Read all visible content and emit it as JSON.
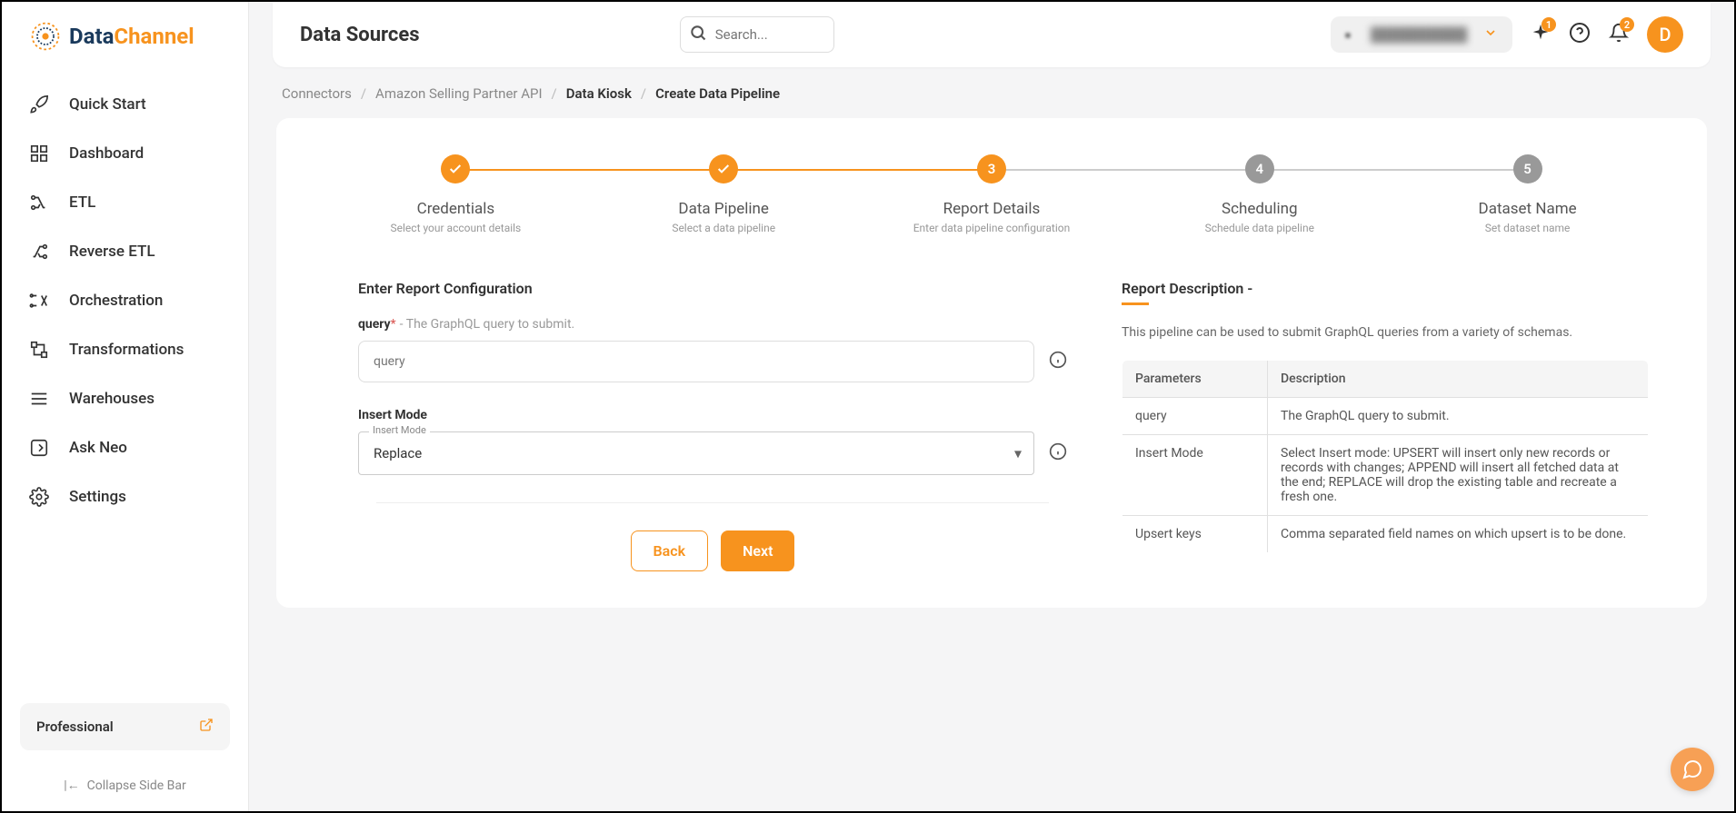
{
  "brand": {
    "part1": "Data",
    "part2": "Channel"
  },
  "sidebar": {
    "items": [
      {
        "label": "Quick Start"
      },
      {
        "label": "Dashboard"
      },
      {
        "label": "ETL"
      },
      {
        "label": "Reverse ETL"
      },
      {
        "label": "Orchestration"
      },
      {
        "label": "Transformations"
      },
      {
        "label": "Warehouses"
      },
      {
        "label": "Ask Neo"
      },
      {
        "label": "Settings"
      }
    ],
    "plan": "Professional",
    "collapse": "Collapse Side Bar"
  },
  "topbar": {
    "title": "Data Sources",
    "search_placeholder": "Search...",
    "workspace": "██████████",
    "badge1": "1",
    "badge2": "2",
    "avatar": "D"
  },
  "breadcrumb": {
    "c0": "Connectors",
    "c1": "Amazon Selling Partner API",
    "c2": "Data Kiosk",
    "c3": "Create Data Pipeline"
  },
  "steps": [
    {
      "title": "Credentials",
      "sub": "Select your account details",
      "num": "✓"
    },
    {
      "title": "Data Pipeline",
      "sub": "Select a data pipeline",
      "num": "✓"
    },
    {
      "title": "Report Details",
      "sub": "Enter data pipeline configuration",
      "num": "3"
    },
    {
      "title": "Scheduling",
      "sub": "Schedule data pipeline",
      "num": "4"
    },
    {
      "title": "Dataset Name",
      "sub": "Set dataset name",
      "num": "5"
    }
  ],
  "form": {
    "section_title": "Enter Report Configuration",
    "query_label": "query",
    "query_required": "*",
    "query_hint": "- The GraphQL query to submit.",
    "query_placeholder": "query",
    "insert_mode_label": "Insert Mode",
    "insert_mode_float": "Insert Mode",
    "insert_mode_value": "Replace",
    "back": "Back",
    "next": "Next"
  },
  "desc": {
    "title": "Report Description -",
    "text": "This pipeline can be used to submit GraphQL queries from a variety of schemas.",
    "th1": "Parameters",
    "th2": "Description",
    "rows": [
      {
        "p": "query",
        "d": "The GraphQL query to submit."
      },
      {
        "p": "Insert Mode",
        "d": "Select Insert mode: UPSERT will insert only new records or records with changes; APPEND will insert all fetched data at the end; REPLACE will drop the existing table and recreate a fresh one."
      },
      {
        "p": "Upsert keys",
        "d": "Comma separated field names on which upsert is to be done."
      }
    ]
  }
}
